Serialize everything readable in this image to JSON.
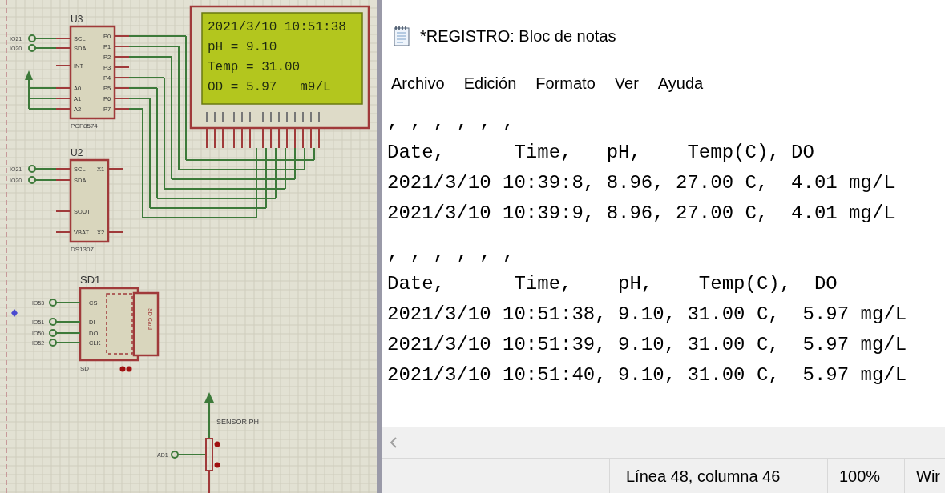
{
  "schematic": {
    "components": [
      {
        "kind": "ic",
        "ref": "U3",
        "part": "PCF8574",
        "left_pins": [
          {
            "name": "SCL",
            "net": "IO21"
          },
          {
            "name": "SDA",
            "net": "IO20"
          },
          {
            "name": "INT"
          },
          {
            "name": "A0"
          },
          {
            "name": "A1"
          },
          {
            "name": "A2"
          }
        ],
        "right_pins": [
          "P0",
          "P1",
          "P2",
          "P3",
          "P4",
          "P5",
          "P6",
          "P7"
        ]
      },
      {
        "kind": "ic",
        "ref": "U2",
        "part": "DS1307",
        "left_pins": [
          {
            "name": "SCL",
            "net": "IO21"
          },
          {
            "name": "SDA",
            "net": "IO20"
          },
          {
            "name": "SOUT"
          },
          {
            "name": "VBAT"
          }
        ],
        "right_pins": [
          "X1",
          "X2"
        ]
      },
      {
        "kind": "lcd",
        "lines": [
          "2021/3/10 10:51:38",
          "pH = 9.10",
          "Temp = 31.00",
          "OD = 5.97   m9/L"
        ]
      },
      {
        "kind": "sdcard",
        "ref": "SD1",
        "part": "SD",
        "card_label": "SD Card",
        "pins": [
          {
            "name": "CS",
            "net": "IO53"
          },
          {
            "name": "DI",
            "net": "IO51"
          },
          {
            "name": "DO",
            "net": "IO50"
          },
          {
            "name": "CLK",
            "net": "IO52"
          }
        ]
      },
      {
        "kind": "pot",
        "label": "SENSOR PH",
        "net": "AD1"
      }
    ]
  },
  "notepad": {
    "title": "*REGISTRO: Bloc de notas",
    "menu": [
      "Archivo",
      "Edición",
      "Formato",
      "Ver",
      "Ayuda"
    ],
    "lines": [
      ", , , , , ,",
      "Date,      Time,   pH,    Temp(C), DO",
      "2021/3/10 10:39:8, 8.96, 27.00 C,  4.01 mg/L",
      "2021/3/10 10:39:9, 8.96, 27.00 C,  4.01 mg/L",
      ", , , , , ,",
      "Date,      Time,    pH,    Temp(C),  DO",
      "2021/3/10 10:51:38, 9.10, 31.00 C,  5.97 mg/L",
      "2021/3/10 10:51:39, 9.10, 31.00 C,  5.97 mg/L",
      "2021/3/10 10:51:40, 9.10, 31.00 C,  5.97 mg/L"
    ],
    "status": {
      "position": "Línea 48, columna 46",
      "zoom": "100%",
      "encoding": "Wir"
    }
  }
}
